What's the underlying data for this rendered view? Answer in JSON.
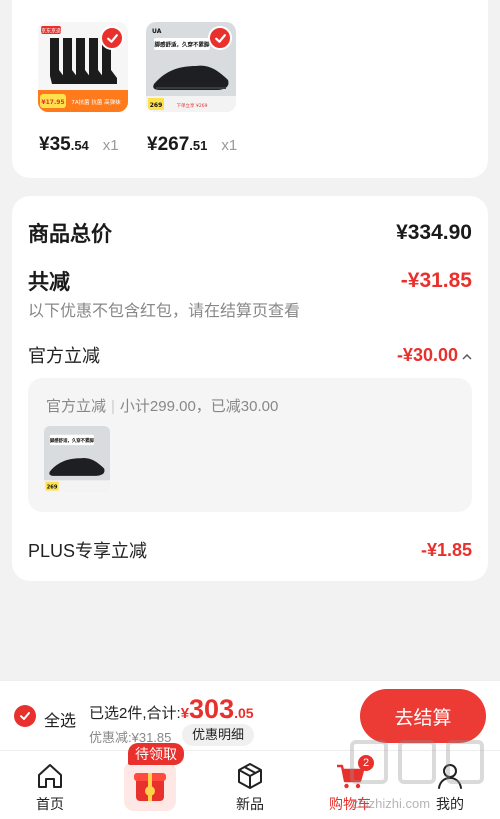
{
  "colors": {
    "accent": "#e8302c",
    "checkout_bg": "#ec3a35",
    "card_bg": "#ffffff",
    "page_bg": "#f2f2f2"
  },
  "items": [
    {
      "price_int": "¥35",
      "price_dec": ".54",
      "qty": "x1",
      "image": "socks-pack",
      "selected": true,
      "img_texts": {
        "tag": "京东京造",
        "price": "¥17.95",
        "promo": "7A抗菌 抗菌 高弹袜"
      }
    },
    {
      "price_int": "¥267",
      "price_dec": ".51",
      "qty": "x1",
      "image": "black-running-shoe",
      "selected": true,
      "img_texts": {
        "brand": "UA",
        "slogan": "脚感舒适，久穿不累脚",
        "price": "269",
        "promo": "下单立享 ¥269"
      }
    }
  ],
  "summary": {
    "total_label": "商品总价",
    "total_value": "¥334.90",
    "discount_label": "共减",
    "discount_value": "-¥31.85",
    "note": "以下优惠不包含红包，请在结算页查看",
    "official_label": "官方立减",
    "official_value": "-¥30.00",
    "official_expand_icon": "chevron-up-icon",
    "detail_title": "官方立减",
    "detail_sub": "小计299.00，已减30.00",
    "detail_thumb": {
      "slogan": "脚感舒适，久穿不累脚",
      "price": "269"
    },
    "plus_label": "PLUS专享立减",
    "plus_value": "-¥1.85"
  },
  "bottom": {
    "select_all": "全选",
    "selected_text": "已选2件,合计:",
    "currency": "¥",
    "total_int": "303",
    "total_dec": ".05",
    "discount_text": "优惠减:¥31.85",
    "detail_button": "优惠明细",
    "checkout": "去结算"
  },
  "tabs": [
    {
      "label": "首页",
      "icon": "home-icon"
    },
    {
      "label": "",
      "icon": "gift-icon",
      "badge": "待领取"
    },
    {
      "label": "新品",
      "icon": "cube-icon"
    },
    {
      "label": "购物车",
      "icon": "cart-icon",
      "badge": "2",
      "active": true
    },
    {
      "label": "我的",
      "icon": "user-icon"
    }
  ],
  "watermark": "zhizhizhi.com"
}
